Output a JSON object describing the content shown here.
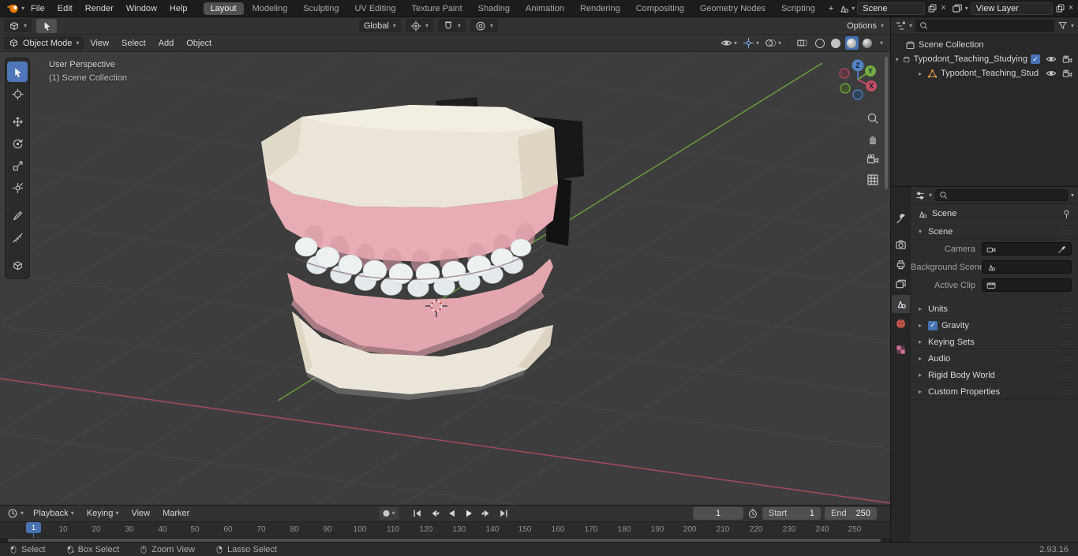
{
  "palette": {
    "accent": "#4772b3",
    "axis_x": "#a84a5e",
    "axis_y": "#6a9e3e",
    "header": "#323232",
    "viewport_bg": "#3d3d3d",
    "model_base": "#eae5d8",
    "model_gum": "#e3a5ae",
    "model_teeth": "#eef1f2"
  },
  "topbar": {
    "menus": [
      "File",
      "Edit",
      "Render",
      "Window",
      "Help"
    ],
    "workspaces": [
      "Layout",
      "Modeling",
      "Sculpting",
      "UV Editing",
      "Texture Paint",
      "Shading",
      "Animation",
      "Rendering",
      "Compositing",
      "Geometry Nodes",
      "Scripting"
    ],
    "active_workspace": "Layout",
    "new_workspace": "+",
    "scene_value": "Scene",
    "view_layer_value": "View Layer"
  },
  "tool_header": {
    "orientation": "Global",
    "options": "Options"
  },
  "mode_header": {
    "mode": "Object Mode",
    "menus": [
      "View",
      "Select",
      "Add",
      "Object"
    ]
  },
  "viewport": {
    "title": "User Perspective",
    "subtitle": "(1) Scene Collection",
    "axis": {
      "x": "X",
      "y": "Y",
      "z": "Z"
    }
  },
  "outliner": {
    "root": "Scene Collection",
    "items": [
      {
        "name": "Typodont_Teaching_Studying",
        "checked": true
      },
      {
        "name": "Typodont_Teaching_Stud"
      }
    ]
  },
  "properties": {
    "breadcrumb": "Scene",
    "scene_section": "Scene",
    "fields": {
      "camera": "Camera",
      "background_scene": "Background Scene",
      "active_clip": "Active Clip"
    },
    "sections": [
      "Units",
      "Gravity",
      "Keying Sets",
      "Audio",
      "Rigid Body World",
      "Custom Properties"
    ]
  },
  "timeline": {
    "menus": [
      "Playback",
      "Keying",
      "View",
      "Marker"
    ],
    "current_frame": "1",
    "start_label": "Start",
    "start_value": "1",
    "end_label": "End",
    "end_value": "250",
    "ticks": [
      "10",
      "20",
      "30",
      "40",
      "50",
      "60",
      "70",
      "80",
      "90",
      "100",
      "110",
      "120",
      "130",
      "140",
      "150",
      "160",
      "170",
      "180",
      "190",
      "200",
      "210",
      "220",
      "230",
      "240",
      "250"
    ]
  },
  "statusbar": {
    "hints": [
      "Select",
      "Box Select",
      "Zoom View",
      "Lasso Select"
    ],
    "version": "2.93.16"
  },
  "icons": {
    "chevron": "▾",
    "tri_right": "▸",
    "tri_down": "▾",
    "check": "✓",
    "close": "×",
    "dots": "::::"
  }
}
